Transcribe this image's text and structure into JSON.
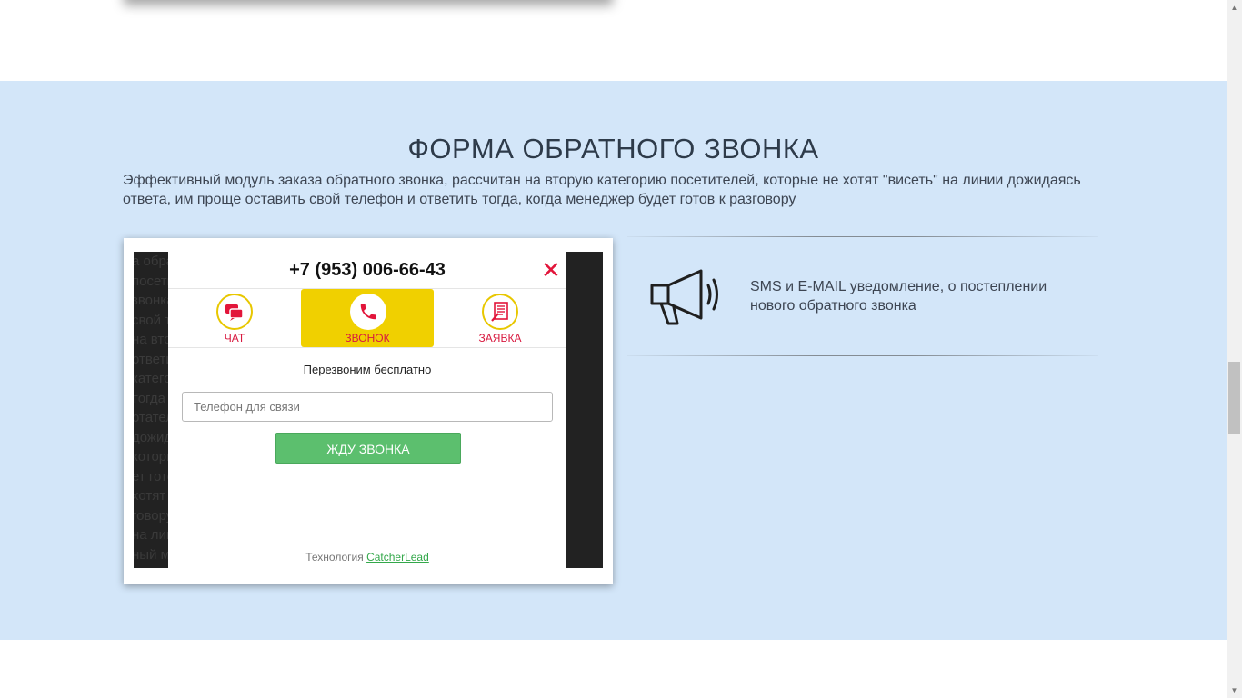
{
  "section": {
    "title": "ФОРМА ОБРАТНОГО ЗВОНКА",
    "description": "Эффективный модуль заказа обратного звонка, рассчитан на вторую категорию посетителей, которые не хотят \"висеть\" на линии дожидаясь ответа, им проще оставить свой телефон и ответить тогда, когда менеджер будет готов к разговору",
    "background_color": "#d3e6f9"
  },
  "widget": {
    "phone": "+7 (953) 006-66-43",
    "close_icon": "close-icon",
    "tabs": [
      {
        "label": "ЧАТ",
        "icon": "chat-icon",
        "active": false
      },
      {
        "label": "ЗВОНОК",
        "icon": "phone-icon",
        "active": true
      },
      {
        "label": "ЗАЯВКА",
        "icon": "request-form-icon",
        "active": false
      }
    ],
    "callback_text": "Перезвоним бесплатно",
    "phone_input": {
      "placeholder": "Телефон для связи",
      "value": ""
    },
    "submit_label": "ЖДУ ЗВОНКА",
    "tech_prefix": "Технология",
    "tech_link": "CatcherLead",
    "colors": {
      "accent_yellow": "#f0d000",
      "button_green": "#5cbf6e",
      "close_red": "#e2153a"
    }
  },
  "feature": {
    "icon": "megaphone-icon",
    "text": "SMS и E-MAIL уведомление, о постеплении нового обратного звонка"
  }
}
